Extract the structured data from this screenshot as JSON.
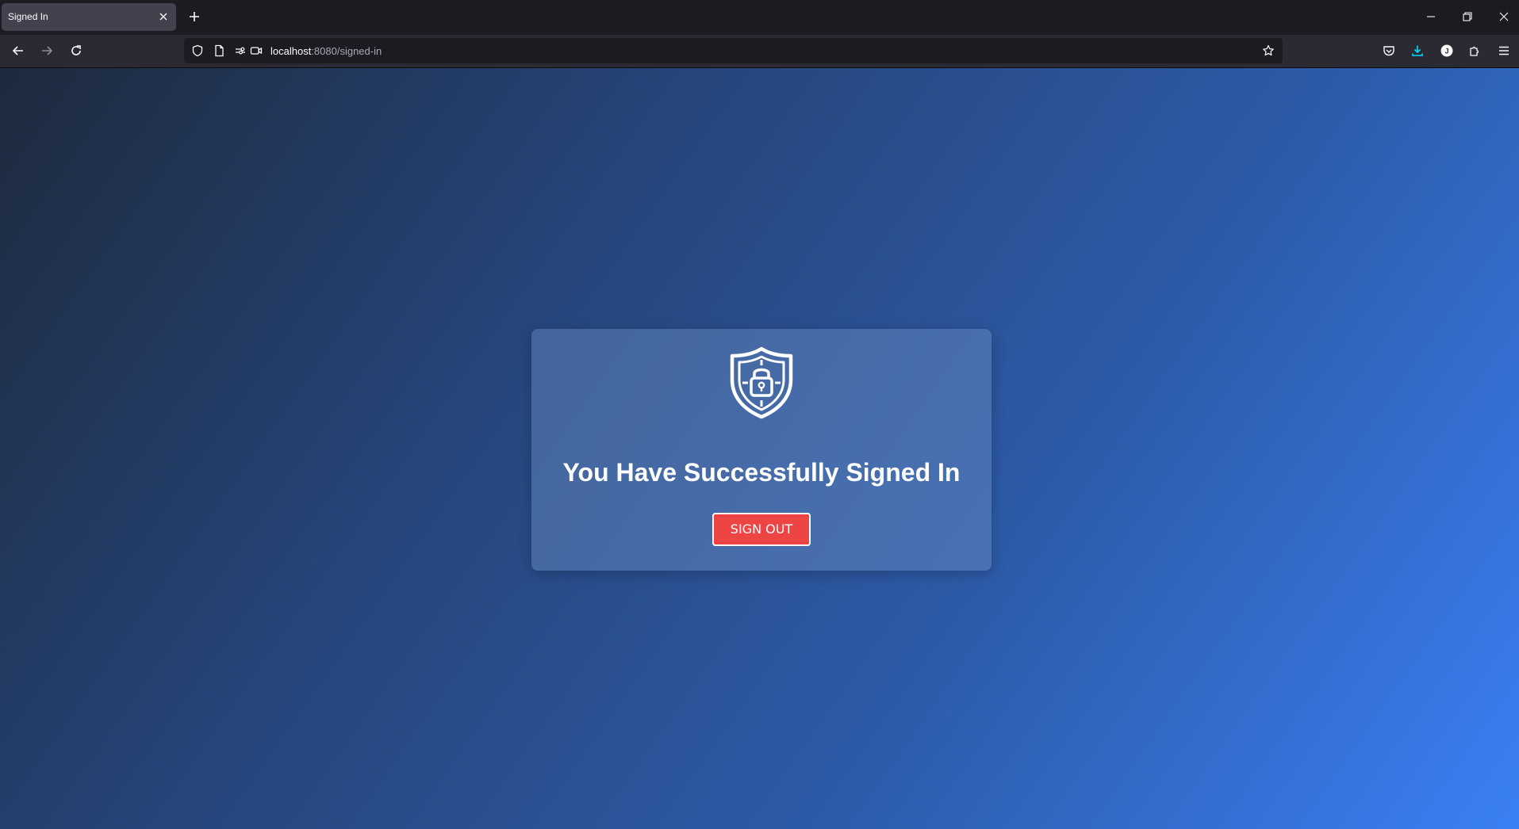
{
  "browser": {
    "tab": {
      "title": "Signed In"
    },
    "url": {
      "host": "localhost",
      "rest": ":8080/signed-in"
    },
    "icons": {
      "back": "arrow-left-icon",
      "forward": "arrow-right-icon",
      "reload": "reload-icon",
      "tracking_protection": "shield-icon",
      "page_info": "document-icon",
      "permissions": "permissions-icon",
      "camera": "camera-icon",
      "bookmark": "star-icon",
      "pocket": "pocket-icon",
      "downloads": "download-icon",
      "account": "account-icon",
      "extensions": "puzzle-icon",
      "menu": "hamburger-menu-icon"
    },
    "colors": {
      "download_accent": "#54ffbd"
    }
  },
  "page": {
    "title": "You Have Successfully Signed In",
    "signout_label": "SIGN OUT",
    "colors": {
      "gradient_start": "#1e2a3d",
      "gradient_end": "#3a80f5",
      "button": "#ef4444"
    }
  }
}
